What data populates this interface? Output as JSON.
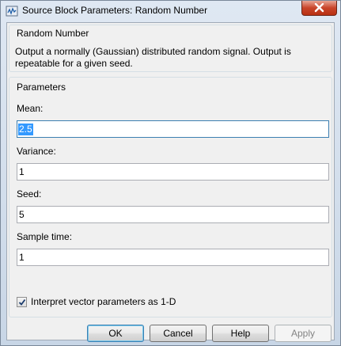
{
  "window": {
    "title": "Source Block Parameters: Random Number"
  },
  "description": {
    "group_label": "Random Number",
    "text": "Output a normally (Gaussian) distributed random signal.  Output is repeatable for a given seed."
  },
  "parameters": {
    "group_label": "Parameters",
    "mean": {
      "label": "Mean:",
      "value": "2.5"
    },
    "variance": {
      "label": "Variance:",
      "value": "1"
    },
    "seed": {
      "label": "Seed:",
      "value": "5"
    },
    "sample_time": {
      "label": "Sample time:",
      "value": "1"
    },
    "interpret_vector": {
      "label": "Interpret vector parameters as 1-D",
      "checked": true
    }
  },
  "buttons": {
    "ok": "OK",
    "cancel": "Cancel",
    "help": "Help",
    "apply": "Apply"
  },
  "icons": {
    "app": "simulink-block-icon",
    "close": "close-icon",
    "check": "checkmark-icon"
  }
}
